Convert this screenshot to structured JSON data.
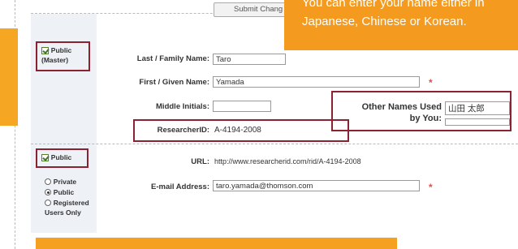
{
  "callout": {
    "line1": "You can enter your name either in",
    "line2": "Japanese, Chinese or Korean."
  },
  "toolbar": {
    "submit_label": "Submit Chang"
  },
  "left_panel": {
    "public_master": {
      "line1": "Public",
      "line2": "(Master)"
    },
    "public2": "Public",
    "privacy_options": [
      "Private",
      "Public",
      "Registered",
      "Users Only"
    ]
  },
  "form": {
    "last_name": {
      "label": "Last / Family Name:",
      "value": "Taro"
    },
    "first_name": {
      "label": "First / Given Name:",
      "value": "Yamada"
    },
    "middle": {
      "label": "Middle Initials:",
      "value": ""
    },
    "researcher_id": {
      "label": "ResearcherID:",
      "value": "A-4194-2008"
    },
    "url": {
      "label": "URL:",
      "value": "http://www.researcherid.com/rid/A-4194-2008"
    },
    "email": {
      "label": "E-mail Address:",
      "value": "taro.yamada@thomson.com"
    },
    "required_mark": "*"
  },
  "other_names": {
    "label_line1": "Other Names Used",
    "label_line2": "by You:",
    "value": "山田 太郎"
  },
  "colors": {
    "orange": "#f39a1f",
    "dark_red": "#8b2232",
    "required": "#d9534f"
  }
}
